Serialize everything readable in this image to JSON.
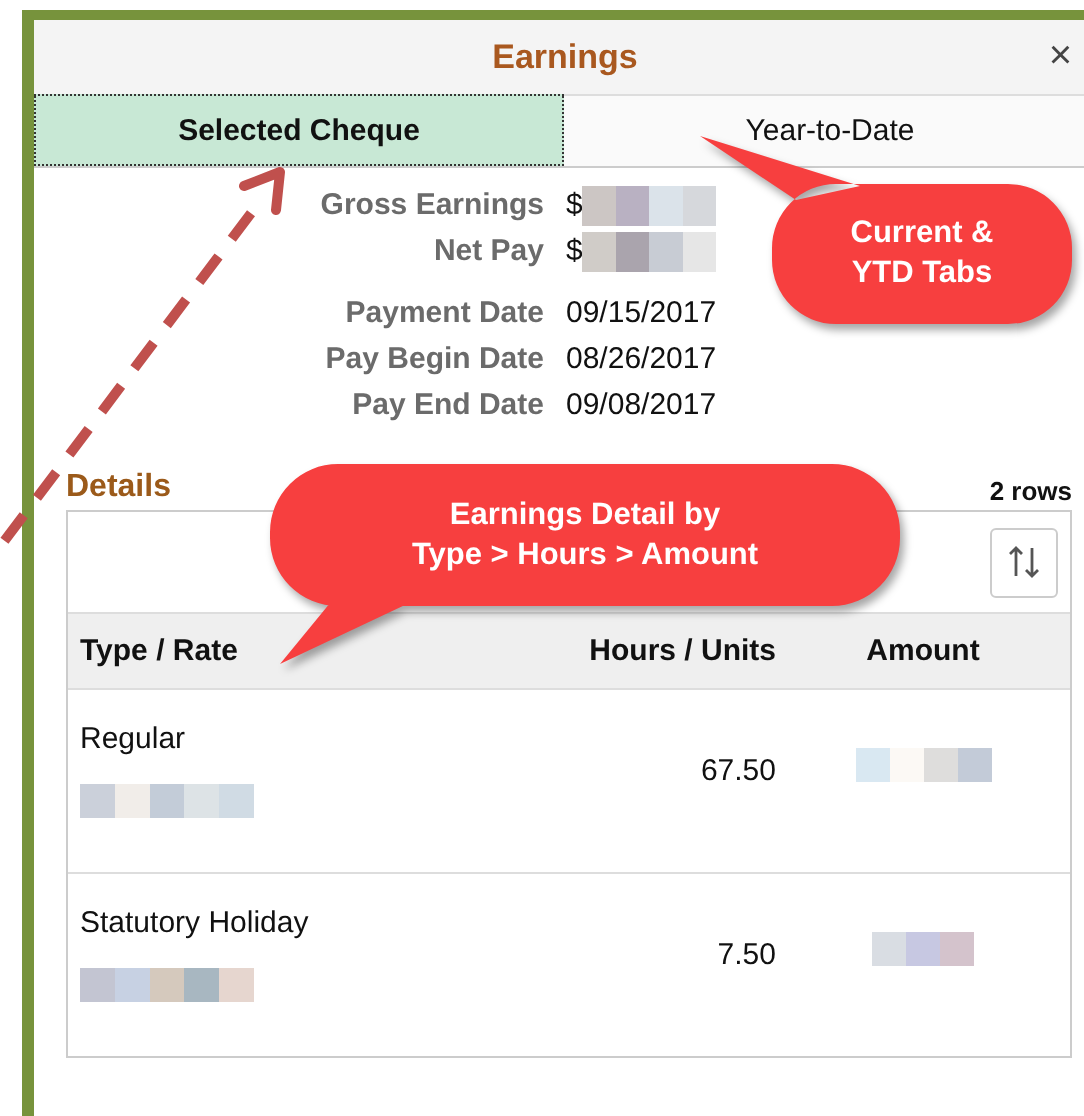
{
  "dialog": {
    "title": "Earnings",
    "close": "×"
  },
  "tabs": [
    {
      "label": "Selected Cheque",
      "selected": true
    },
    {
      "label": "Year-to-Date",
      "selected": false
    }
  ],
  "summary": [
    {
      "label": "Gross Earnings",
      "value": "$"
    },
    {
      "label": "Net Pay",
      "value": "$"
    }
  ],
  "dates": [
    {
      "label": "Payment Date",
      "value": "09/15/2017"
    },
    {
      "label": "Pay Begin Date",
      "value": "08/26/2017"
    },
    {
      "label": "Pay End Date",
      "value": "09/08/2017"
    }
  ],
  "details": {
    "title": "Details",
    "row_count": "2 rows",
    "columns": [
      "Type / Rate",
      "Hours / Units",
      "Amount"
    ],
    "rows": [
      {
        "type": "Regular",
        "hours": "67.50"
      },
      {
        "type": "Statutory Holiday",
        "hours": "7.50"
      }
    ]
  },
  "callouts": [
    {
      "lines": [
        "Current &",
        "YTD Tabs"
      ]
    },
    {
      "lines": [
        "Earnings Detail by",
        "Type > Hours > Amount"
      ]
    }
  ]
}
